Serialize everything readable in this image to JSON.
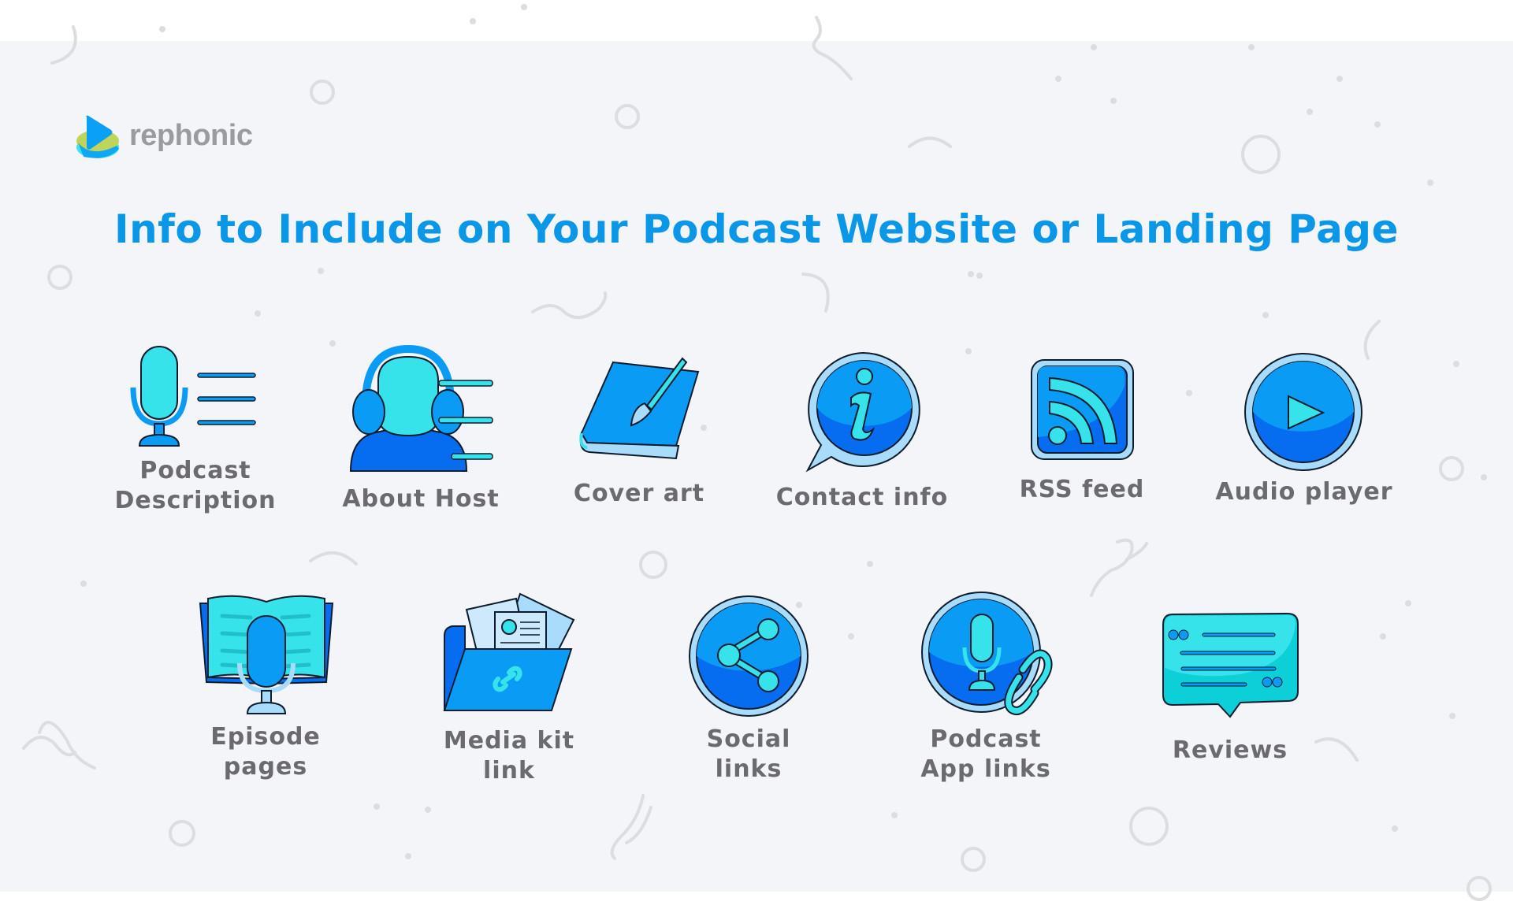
{
  "brand": {
    "name": "rephonic",
    "logo_icon": "play-disc-logo-icon",
    "colors": {
      "blue": "#0aa0f5",
      "green": "#bcd55a",
      "cyan": "#38e4ee"
    }
  },
  "title": "Info to Include on Your Podcast Website or Landing Page",
  "colors": {
    "title": "#0a97e8",
    "label": "#6a6a70",
    "background": "#f3f5f9",
    "icon_blue": "#0a9cf5",
    "icon_dark_blue": "#066cf0",
    "icon_cyan": "#36e3ea",
    "icon_light": "#a8dcfa"
  },
  "items": [
    {
      "icon": "microphone-description-icon",
      "lines": [
        "Podcast",
        "Description"
      ]
    },
    {
      "icon": "host-headphones-icon",
      "lines": [
        "About Host"
      ]
    },
    {
      "icon": "book-paintbrush-icon",
      "lines": [
        "Cover art"
      ]
    },
    {
      "icon": "info-speech-bubble-icon",
      "lines": [
        "Contact info"
      ]
    },
    {
      "icon": "rss-feed-icon",
      "lines": [
        "RSS feed"
      ]
    },
    {
      "icon": "play-button-icon",
      "lines": [
        "Audio player"
      ]
    },
    {
      "icon": "open-book-microphone-icon",
      "lines": [
        "Episode",
        "pages"
      ]
    },
    {
      "icon": "folder-link-icon",
      "lines": [
        "Media kit",
        "link"
      ]
    },
    {
      "icon": "share-icon",
      "lines": [
        "Social",
        "links"
      ]
    },
    {
      "icon": "microphone-chain-link-icon",
      "lines": [
        "Podcast",
        "App links"
      ]
    },
    {
      "icon": "quote-speech-bubble-icon",
      "lines": [
        "Reviews"
      ]
    }
  ]
}
